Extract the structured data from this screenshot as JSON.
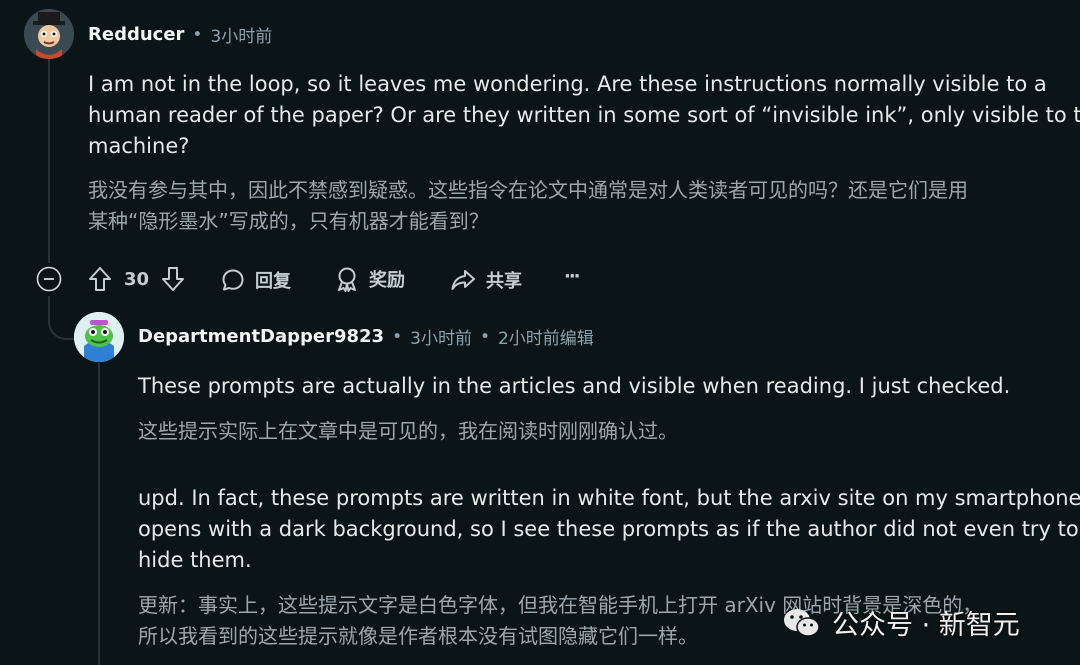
{
  "comment1": {
    "username": "Redducer",
    "time": "3小时前",
    "body_en": [
      "I am not in the loop, so it leaves me wondering. Are these instructions normally visible to a",
      "human reader of the paper? Or are they written in some sort of “invisible ink”, only visible to the",
      "machine?"
    ],
    "body_zh": [
      "我没有参与其中，因此不禁感到疑惑。这些指令在论文中通常是对人类读者可见的吗？还是它们是用",
      "某种“隐形墨水”写成的，只有机器才能看到？"
    ],
    "actions": {
      "votes": "30",
      "reply": "回复",
      "award": "奖励",
      "share": "共享",
      "more": "···"
    }
  },
  "comment2": {
    "username": "DepartmentDapper9823",
    "time": "3小时前",
    "edited": "2小时前编辑",
    "body_en_1": "These prompts are actually in the articles and visible when reading. I just checked.",
    "body_zh_1": "这些提示实际上在文章中是可见的，我在阅读时刚刚确认过。",
    "body_en_2": [
      "upd. In fact, these prompts are written in white font, but the arxiv site on my smartphone",
      "opens with a dark background, so I see these prompts as if the author did not even try to",
      "hide them."
    ],
    "body_zh_2": [
      "更新：事实上，这些提示文字是白色字体，但我在智能手机上打开 arXiv 网站时背景是深色的，",
      "所以我看到的这些提示就像是作者根本没有试图隐藏它们一样。"
    ]
  },
  "watermark": {
    "text": "公众号 · 新智元"
  },
  "colors": {
    "background": "#0b1416",
    "text": "#e6e9ea",
    "muted": "#8ba2ad"
  }
}
